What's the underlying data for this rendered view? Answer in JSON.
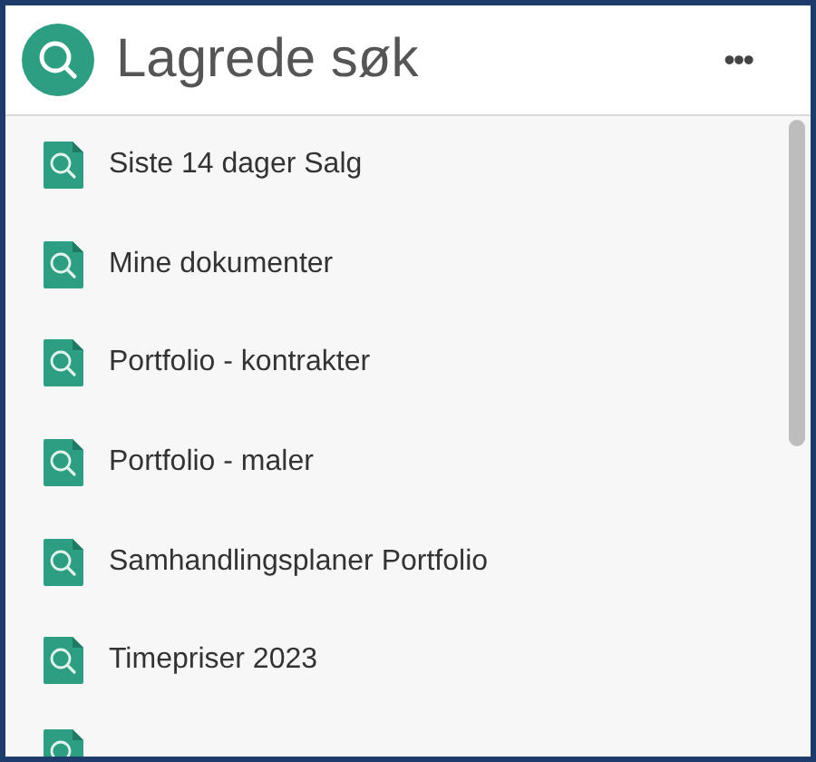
{
  "header": {
    "title": "Lagrede søk",
    "menu_label": "•••"
  },
  "searches": [
    {
      "label": "Siste 14 dager Salg"
    },
    {
      "label": "Mine dokumenter"
    },
    {
      "label": "Portfolio - kontrakter"
    },
    {
      "label": "Portfolio - maler"
    },
    {
      "label": "Samhandlingsplaner Portfolio"
    },
    {
      "label": "Timepriser 2023"
    }
  ]
}
